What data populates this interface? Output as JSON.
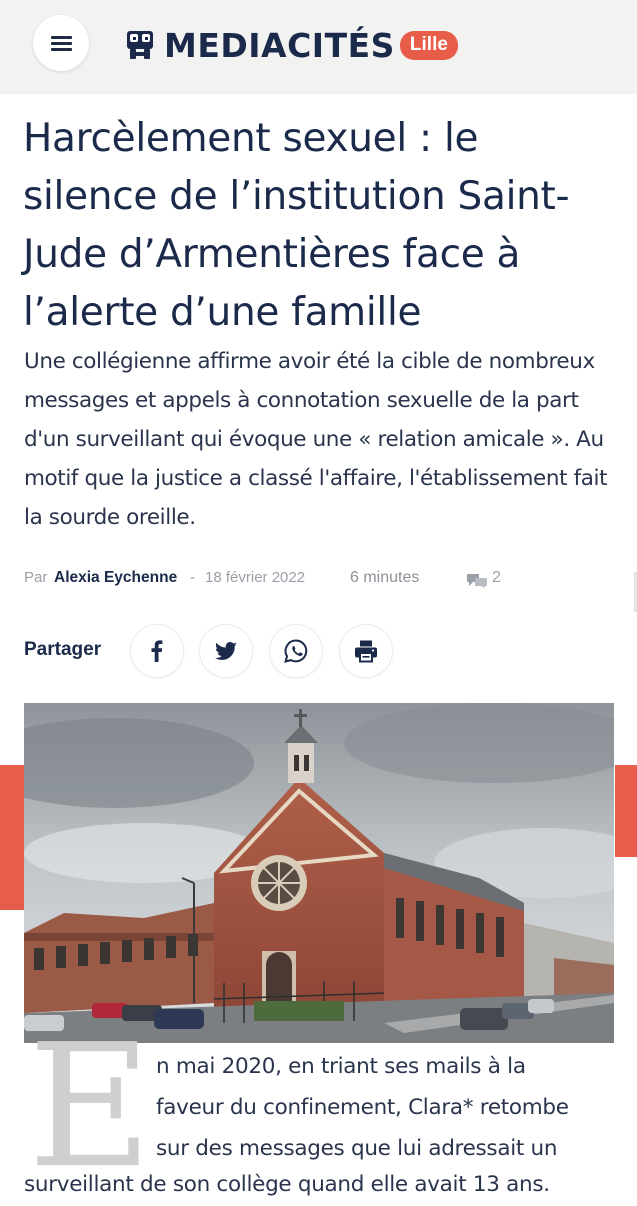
{
  "header": {
    "logo_text": "MEDIACITÉS",
    "city": "Lille",
    "menu_icon": "hamburger-icon",
    "logo_icon": "mediacites-logo-icon"
  },
  "article": {
    "title": "Harcèlement sexuel : le silence de l’institution Saint-Jude d’Armentières face à l’alerte d’une famille",
    "lead": "Une collégienne affirme avoir été la cible de nombreux messages et appels à connotation sexuelle de la part d'un surveillant qui évoque une « relation amicale ». Au motif que la justice a classé l'affaire, l'établissement fait la sourde oreille.",
    "meta": {
      "by": "Par",
      "author": "Alexia Eychenne",
      "separator": "-",
      "date": "18 février 2022",
      "reading_time": "6 minutes",
      "comments_count": "2",
      "comments_icon": "comment-icon"
    },
    "share": {
      "label": "Partager",
      "buttons": [
        {
          "name": "facebook",
          "icon": "facebook-icon"
        },
        {
          "name": "twitter",
          "icon": "twitter-icon"
        },
        {
          "name": "whatsapp",
          "icon": "whatsapp-icon"
        },
        {
          "name": "print",
          "icon": "print-icon"
        }
      ]
    },
    "hero_image": {
      "subject": "church-building-photo"
    },
    "body": {
      "dropcap": "E",
      "lines": [
        "n mai 2020, en triant ses mails à la",
        "faveur du confinement, Clara* retombe",
        "sur des messages que lui adressait un"
      ],
      "cut_line": "surveillant de son collège quand elle avait 13 ans."
    }
  },
  "colors": {
    "accent": "#e85d4a",
    "navy": "#1b2a4a",
    "header_bg": "#f2f2f0",
    "muted": "#9aa0a8"
  }
}
